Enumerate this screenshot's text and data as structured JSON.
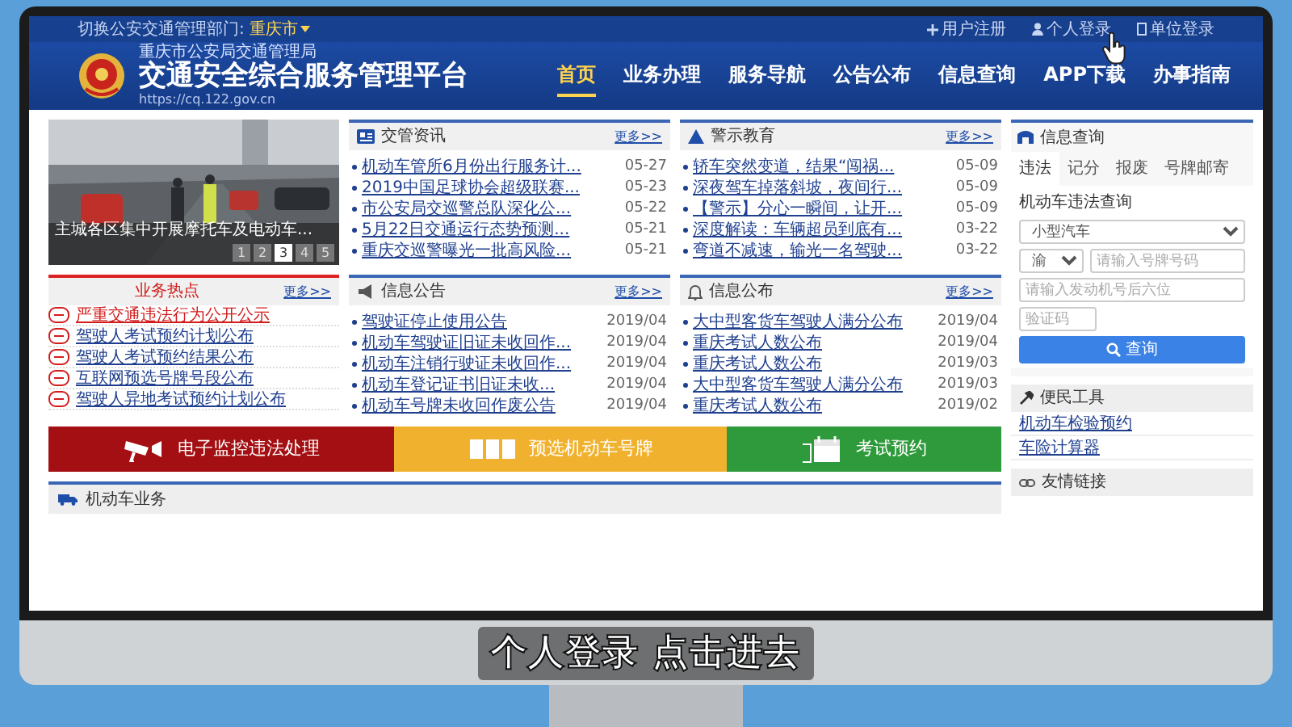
{
  "top_bar": {
    "department_label": "切换公安交通管理部门:",
    "city": "重庆市",
    "links": [
      {
        "kind": "register",
        "label": "用户注册"
      },
      {
        "kind": "personal",
        "label": "个人登录"
      },
      {
        "kind": "company",
        "label": "单位登录"
      }
    ]
  },
  "header": {
    "org": "重庆市公安局交通管理局",
    "title": "交通安全综合服务管理平台",
    "url": "https://cq.122.gov.cn",
    "nav": [
      {
        "label": "首页",
        "selected": true
      },
      {
        "label": "业务办理",
        "selected": false
      },
      {
        "label": "服务导航",
        "selected": false
      },
      {
        "label": "公告公布",
        "selected": false
      },
      {
        "label": "信息查询",
        "selected": false
      },
      {
        "label": "APP下载",
        "selected": false
      },
      {
        "label": "办事指南",
        "selected": false
      }
    ]
  },
  "slideshow": {
    "caption": "主城各区集中开展摩托车及电动车...",
    "pages": [
      {
        "label": "1",
        "selected": false
      },
      {
        "label": "2",
        "selected": false
      },
      {
        "label": "3",
        "selected": true
      },
      {
        "label": "4",
        "selected": false
      },
      {
        "label": "5",
        "selected": false
      }
    ]
  },
  "hot_topics": {
    "title": "业务热点",
    "more": "更多>>",
    "items": [
      {
        "text": "严重交通违法行为公开公示",
        "highlighted": true
      },
      {
        "text": "驾驶人考试预约计划公布",
        "highlighted": false
      },
      {
        "text": "驾驶人考试预约结果公布",
        "highlighted": false
      },
      {
        "text": "互联网预选号牌号段公布",
        "highlighted": false
      },
      {
        "text": "驾驶人异地考试预约计划公布",
        "highlighted": false
      }
    ]
  },
  "news_panels": [
    {
      "kind": "news",
      "title": "交管资讯",
      "more": "更多>>",
      "items": [
        {
          "text": "机动车管所6月份出行服务计...",
          "date": "05-27"
        },
        {
          "text": "2019中国足球协会超级联赛...",
          "date": "05-23"
        },
        {
          "text": "市公安局交巡警总队深化公...",
          "date": "05-22"
        },
        {
          "text": "5月22日交通运行态势预测...",
          "date": "05-21"
        },
        {
          "text": "重庆交巡警曝光一批高风险...",
          "date": "05-21"
        }
      ]
    },
    {
      "kind": "warning",
      "title": "警示教育",
      "more": "更多>>",
      "items": [
        {
          "text": "轿车突然变道，结果“闯祸...",
          "date": "05-09"
        },
        {
          "text": "深夜驾车掉落斜坡，夜间行...",
          "date": "05-09"
        },
        {
          "text": "【警示】分心一瞬间，让开...",
          "date": "05-09"
        },
        {
          "text": "深度解读：车辆超员到底有...",
          "date": "03-22"
        },
        {
          "text": "弯道不减速，输光一名驾驶...",
          "date": "03-22"
        }
      ]
    },
    {
      "kind": "notice",
      "title": "信息公告",
      "more": "更多>>",
      "items": [
        {
          "text": "驾驶证停止使用公告",
          "date": "2019/04"
        },
        {
          "text": "机动车驾驶证旧证未收回作...",
          "date": "2019/04"
        },
        {
          "text": "机动车注销行驶证未收回作...",
          "date": "2019/04"
        },
        {
          "text": "机动车登记证书旧证未收...",
          "date": "2019/04"
        },
        {
          "text": "机动车号牌未收回作废公告",
          "date": "2019/04"
        }
      ]
    },
    {
      "kind": "bell",
      "title": "信息公布",
      "more": "更多>>",
      "items": [
        {
          "text": "大中型客货车驾驶人满分公布",
          "date": "2019/04"
        },
        {
          "text": "重庆考试人数公布",
          "date": "2019/04"
        },
        {
          "text": "重庆考试人数公布",
          "date": "2019/03"
        },
        {
          "text": "大中型客货车驾驶人满分公布",
          "date": "2019/03"
        },
        {
          "text": "重庆考试人数公布",
          "date": "2019/02"
        }
      ]
    }
  ],
  "banners": [
    {
      "kind": "camera",
      "label": "电子监控违法处理",
      "color": "#a30f12"
    },
    {
      "kind": "plate",
      "label": "预选机动车号牌",
      "color": "#f0b22e"
    },
    {
      "kind": "calendar",
      "label": "考试预约",
      "color": "#2f9a3c"
    }
  ],
  "vehicle_section": {
    "title": "机动车业务"
  },
  "query": {
    "title": "信息查询",
    "tabs": [
      {
        "label": "违法",
        "selected": true
      },
      {
        "label": "记分",
        "selected": false
      },
      {
        "label": "报废",
        "selected": false
      },
      {
        "label": "号牌邮寄",
        "selected": false
      }
    ],
    "form_title": "机动车违法查询",
    "vehicle_type": "小型汽车",
    "province": "渝",
    "plate_placeholder": "请输入号牌号码",
    "engine_placeholder": "请输入发动机号后六位",
    "captcha_placeholder": "验证码",
    "submit": "查询"
  },
  "tools": {
    "title": "便民工具",
    "links": [
      "机动车检验预约",
      "车险计算器"
    ]
  },
  "links_panel": {
    "title": "友情链接"
  },
  "subtitle": "个人登录 点击进去"
}
